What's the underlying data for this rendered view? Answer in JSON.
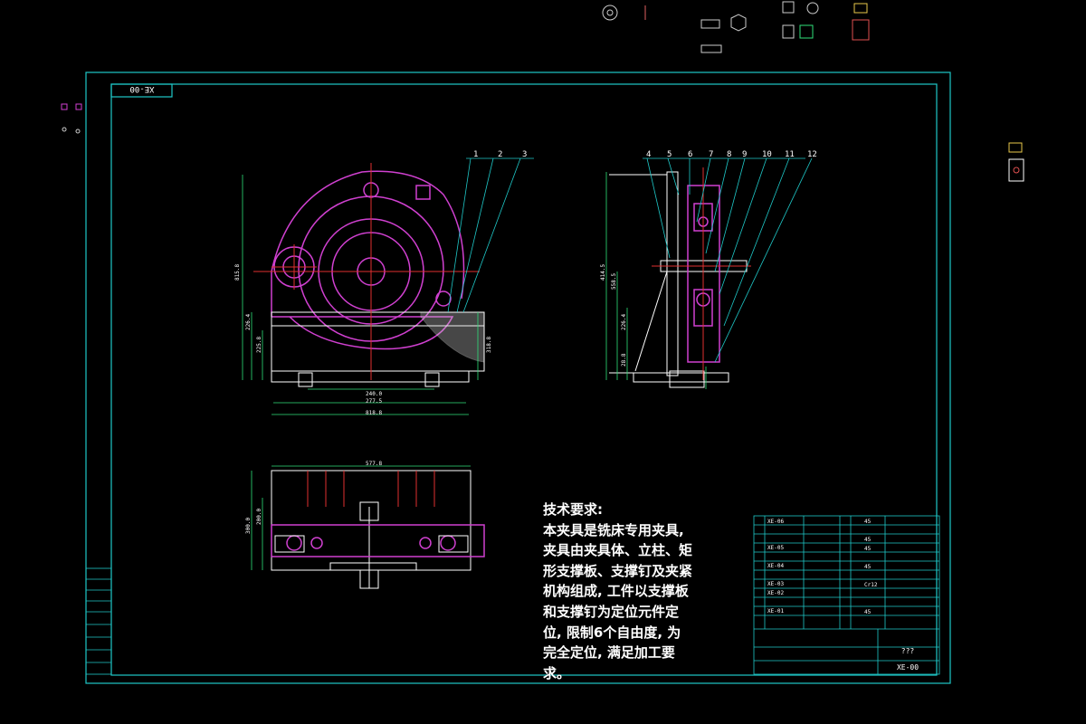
{
  "frame": {
    "code_label": "XE-00"
  },
  "title_block": {
    "drawing_no": "XE-00",
    "title_mark": "???"
  },
  "callouts": [
    "1",
    "2",
    "3",
    "4",
    "5",
    "6",
    "7",
    "8",
    "9",
    "10",
    "11",
    "12"
  ],
  "dimensions": {
    "front_w1": "240.0",
    "front_w2": "277.5",
    "front_w3": "818.8",
    "top_w": "577.8",
    "front_h1": "815.8",
    "front_h2": "226.4",
    "front_h3": "225.8",
    "front_h4": "318.8",
    "side_h1": "414.5",
    "side_h2": "558.5",
    "side_h3": "226.4",
    "side_h4": "28.8",
    "top_h1": "300.0",
    "top_h2": "200.0"
  },
  "tech_requirements": {
    "heading": "技术要求:",
    "lines": [
      "本夹具是铣床专用夹具,",
      "夹具由夹具体、立柱、矩",
      "形支撑板、支撑钉及夹紧",
      "机构组成, 工件以支撑板",
      "和支撑钉为定位元件定",
      "位, 限制6个自由度, 为",
      "完全定位, 满足加工要",
      "求。"
    ]
  },
  "colors": {
    "background": "#000000",
    "frame": "#1fc8c8",
    "part_outline": "#d040d0",
    "center_line": "#e03030",
    "dimension": "#2fe07a",
    "text": "#ffffff"
  }
}
